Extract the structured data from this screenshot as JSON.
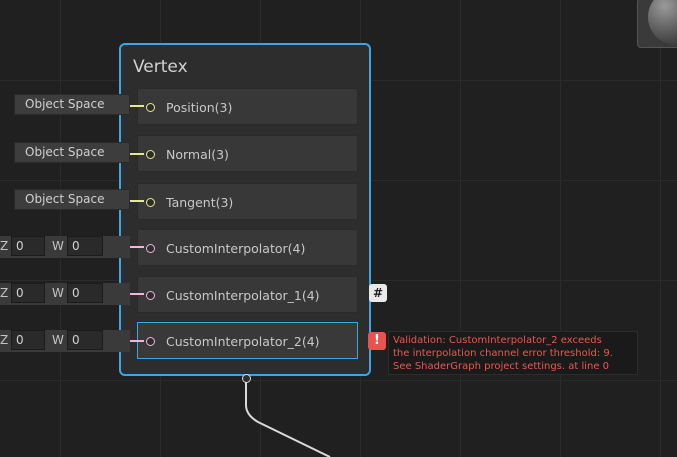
{
  "node": {
    "title": "Vertex"
  },
  "slots": [
    {
      "label": "Position(3)",
      "input": "Object Space",
      "kind": "space",
      "color": "#e6eb8a"
    },
    {
      "label": "Normal(3)",
      "input": "Object Space",
      "kind": "space",
      "color": "#e6eb8a"
    },
    {
      "label": "Tangent(3)",
      "input": "Object Space",
      "kind": "space",
      "color": "#e6eb8a"
    },
    {
      "label": "CustomInterpolator(4)",
      "kind": "vector",
      "z_label": "Z",
      "z_value": "0",
      "w_label": "W",
      "w_value": "0",
      "color": "#f2b3dc"
    },
    {
      "label": "CustomInterpolator_1(4)",
      "kind": "vector",
      "z_label": "Z",
      "z_value": "0",
      "w_label": "W",
      "w_value": "0",
      "color": "#f2b3dc"
    },
    {
      "label": "CustomInterpolator_2(4)",
      "kind": "vector",
      "z_label": "Z",
      "z_value": "0",
      "w_label": "W",
      "w_value": "0",
      "color": "#f2b3dc"
    }
  ],
  "badges": {
    "hash_icon": "hash-icon",
    "hash_glyph": "#",
    "error_icon": "error-icon",
    "error_glyph": "!"
  },
  "tooltip": {
    "lines": [
      "Validation: CustomInterpolator_2 exceeds",
      "the interpolation channel error threshold: 9.",
      "See ShaderGraph project settings. at line 0"
    ]
  },
  "colors": {
    "selection": "#3ea5e4",
    "error": "#e8534f"
  }
}
